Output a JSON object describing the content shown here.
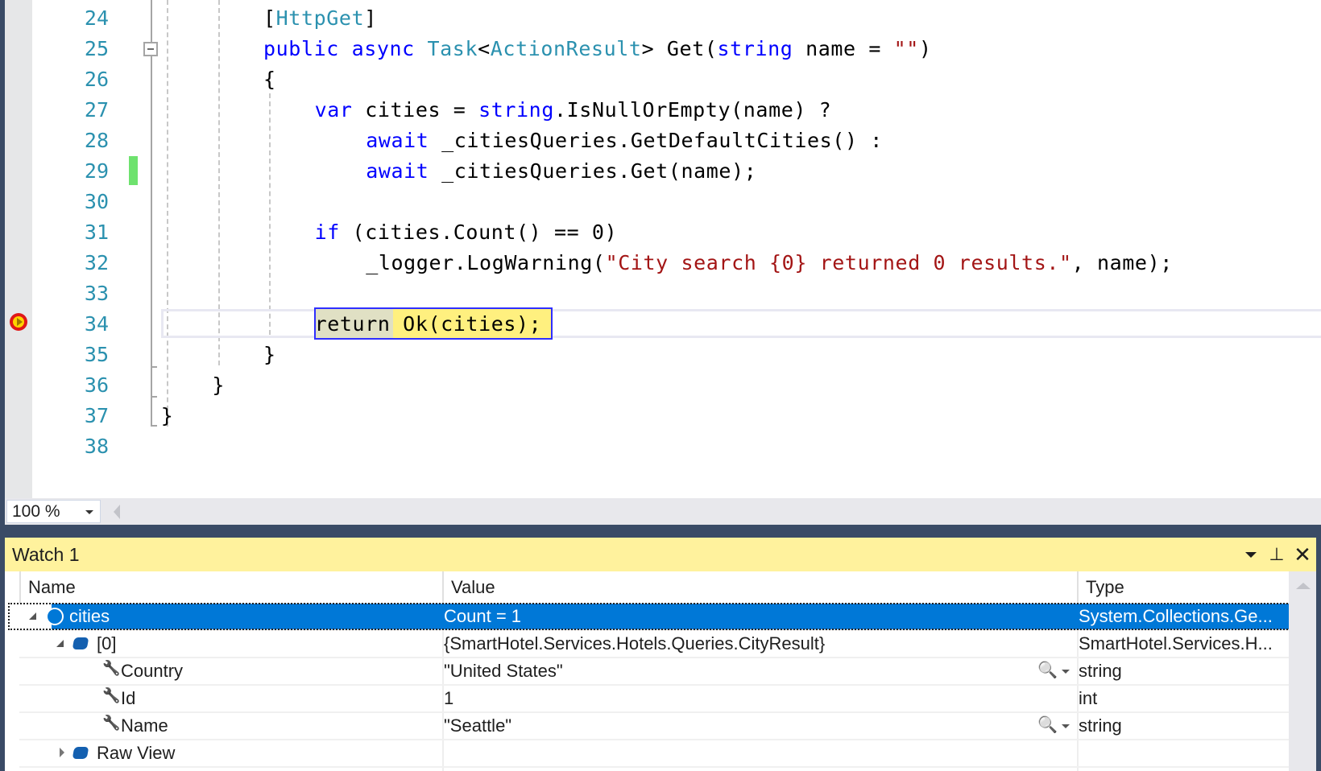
{
  "editor": {
    "lines": [
      {
        "number": "24",
        "indent": 0,
        "tokens": [
          {
            "t": "[",
            "c": "pln"
          },
          {
            "t": "HttpGet",
            "c": "typ"
          },
          {
            "t": "]",
            "c": "pln"
          }
        ]
      },
      {
        "number": "25",
        "indent": 0,
        "tokens": [
          {
            "t": "public",
            "c": "kw"
          },
          {
            "t": " ",
            "c": "pln"
          },
          {
            "t": "async",
            "c": "kw"
          },
          {
            "t": " ",
            "c": "pln"
          },
          {
            "t": "Task",
            "c": "typ"
          },
          {
            "t": "<",
            "c": "pln"
          },
          {
            "t": "ActionResult",
            "c": "typ"
          },
          {
            "t": "> Get(",
            "c": "pln"
          },
          {
            "t": "string",
            "c": "kw"
          },
          {
            "t": " name = ",
            "c": "pln"
          },
          {
            "t": "\"\"",
            "c": "str"
          },
          {
            "t": ")",
            "c": "pln"
          }
        ]
      },
      {
        "number": "26",
        "indent": 0,
        "tokens": [
          {
            "t": "{",
            "c": "pln"
          }
        ]
      },
      {
        "number": "27",
        "indent": 1,
        "tokens": [
          {
            "t": "var",
            "c": "kw"
          },
          {
            "t": " cities = ",
            "c": "pln"
          },
          {
            "t": "string",
            "c": "kw"
          },
          {
            "t": ".IsNullOrEmpty(name) ?",
            "c": "pln"
          }
        ]
      },
      {
        "number": "28",
        "indent": 2,
        "tokens": [
          {
            "t": "await",
            "c": "kw"
          },
          {
            "t": " _citiesQueries.GetDefaultCities() :",
            "c": "pln"
          }
        ]
      },
      {
        "number": "29",
        "indent": 2,
        "tokens": [
          {
            "t": "await",
            "c": "kw"
          },
          {
            "t": " _citiesQueries.Get(name);",
            "c": "pln"
          }
        ]
      },
      {
        "number": "30",
        "indent": 0,
        "tokens": []
      },
      {
        "number": "31",
        "indent": 1,
        "tokens": [
          {
            "t": "if",
            "c": "kw"
          },
          {
            "t": " (cities.Count() == 0)",
            "c": "pln"
          }
        ]
      },
      {
        "number": "32",
        "indent": 2,
        "tokens": [
          {
            "t": "_logger.LogWarning(",
            "c": "pln"
          },
          {
            "t": "\"City search {0} returned 0 results.\"",
            "c": "str"
          },
          {
            "t": ", name);",
            "c": "pln"
          }
        ]
      },
      {
        "number": "33",
        "indent": 0,
        "tokens": []
      },
      {
        "number": "34",
        "indent": 1,
        "tokens": [
          {
            "t": "return",
            "c": "kw-ret"
          },
          {
            "t": " Ok(cities);",
            "c": "pln"
          }
        ]
      },
      {
        "number": "35",
        "indent": 0,
        "tokens": [
          {
            "t": "}",
            "c": "pln"
          }
        ]
      },
      {
        "number": "36",
        "indent": -1,
        "tokens": [
          {
            "t": "}",
            "c": "pln"
          }
        ]
      },
      {
        "number": "37",
        "indent": -2,
        "tokens": [
          {
            "t": "}",
            "c": "pln"
          }
        ]
      },
      {
        "number": "38",
        "indent": 0,
        "tokens": []
      }
    ],
    "current_line": "34",
    "breakpoint_line": "34",
    "changed_line": "29",
    "zoom_level": "100 %"
  },
  "watch": {
    "title": "Watch 1",
    "columns": {
      "name": "Name",
      "value": "Value",
      "type": "Type"
    },
    "rows": [
      {
        "name": "cities",
        "value": "Count = 1",
        "type": "System.Collections.Ge...",
        "depth": 0,
        "expander": "open",
        "icon": "object-outline-icon",
        "selected": true,
        "visualizer": false
      },
      {
        "name": "[0]",
        "value": "{SmartHotel.Services.Hotels.Queries.CityResult}",
        "type": "SmartHotel.Services.H...",
        "depth": 1,
        "expander": "open",
        "icon": "object-icon",
        "selected": false,
        "visualizer": false
      },
      {
        "name": "Country",
        "value": "\"United States\"",
        "type": "string",
        "depth": 2,
        "expander": "none",
        "icon": "wrench-icon",
        "selected": false,
        "visualizer": true
      },
      {
        "name": "Id",
        "value": "1",
        "type": "int",
        "depth": 2,
        "expander": "none",
        "icon": "wrench-icon",
        "selected": false,
        "visualizer": false
      },
      {
        "name": "Name",
        "value": "\"Seattle\"",
        "type": "string",
        "depth": 2,
        "expander": "none",
        "icon": "wrench-icon",
        "selected": false,
        "visualizer": true
      },
      {
        "name": "Raw View",
        "value": "",
        "type": "",
        "depth": 1,
        "expander": "closed",
        "icon": "object-icon",
        "selected": false,
        "visualizer": false
      }
    ],
    "toolbar": {
      "dropdown_icon": "dropdown-arrow-icon",
      "pin_icon": "pin-icon",
      "close_icon": "close-icon",
      "pin_glyph": "⊥",
      "close_glyph": "✕"
    }
  }
}
